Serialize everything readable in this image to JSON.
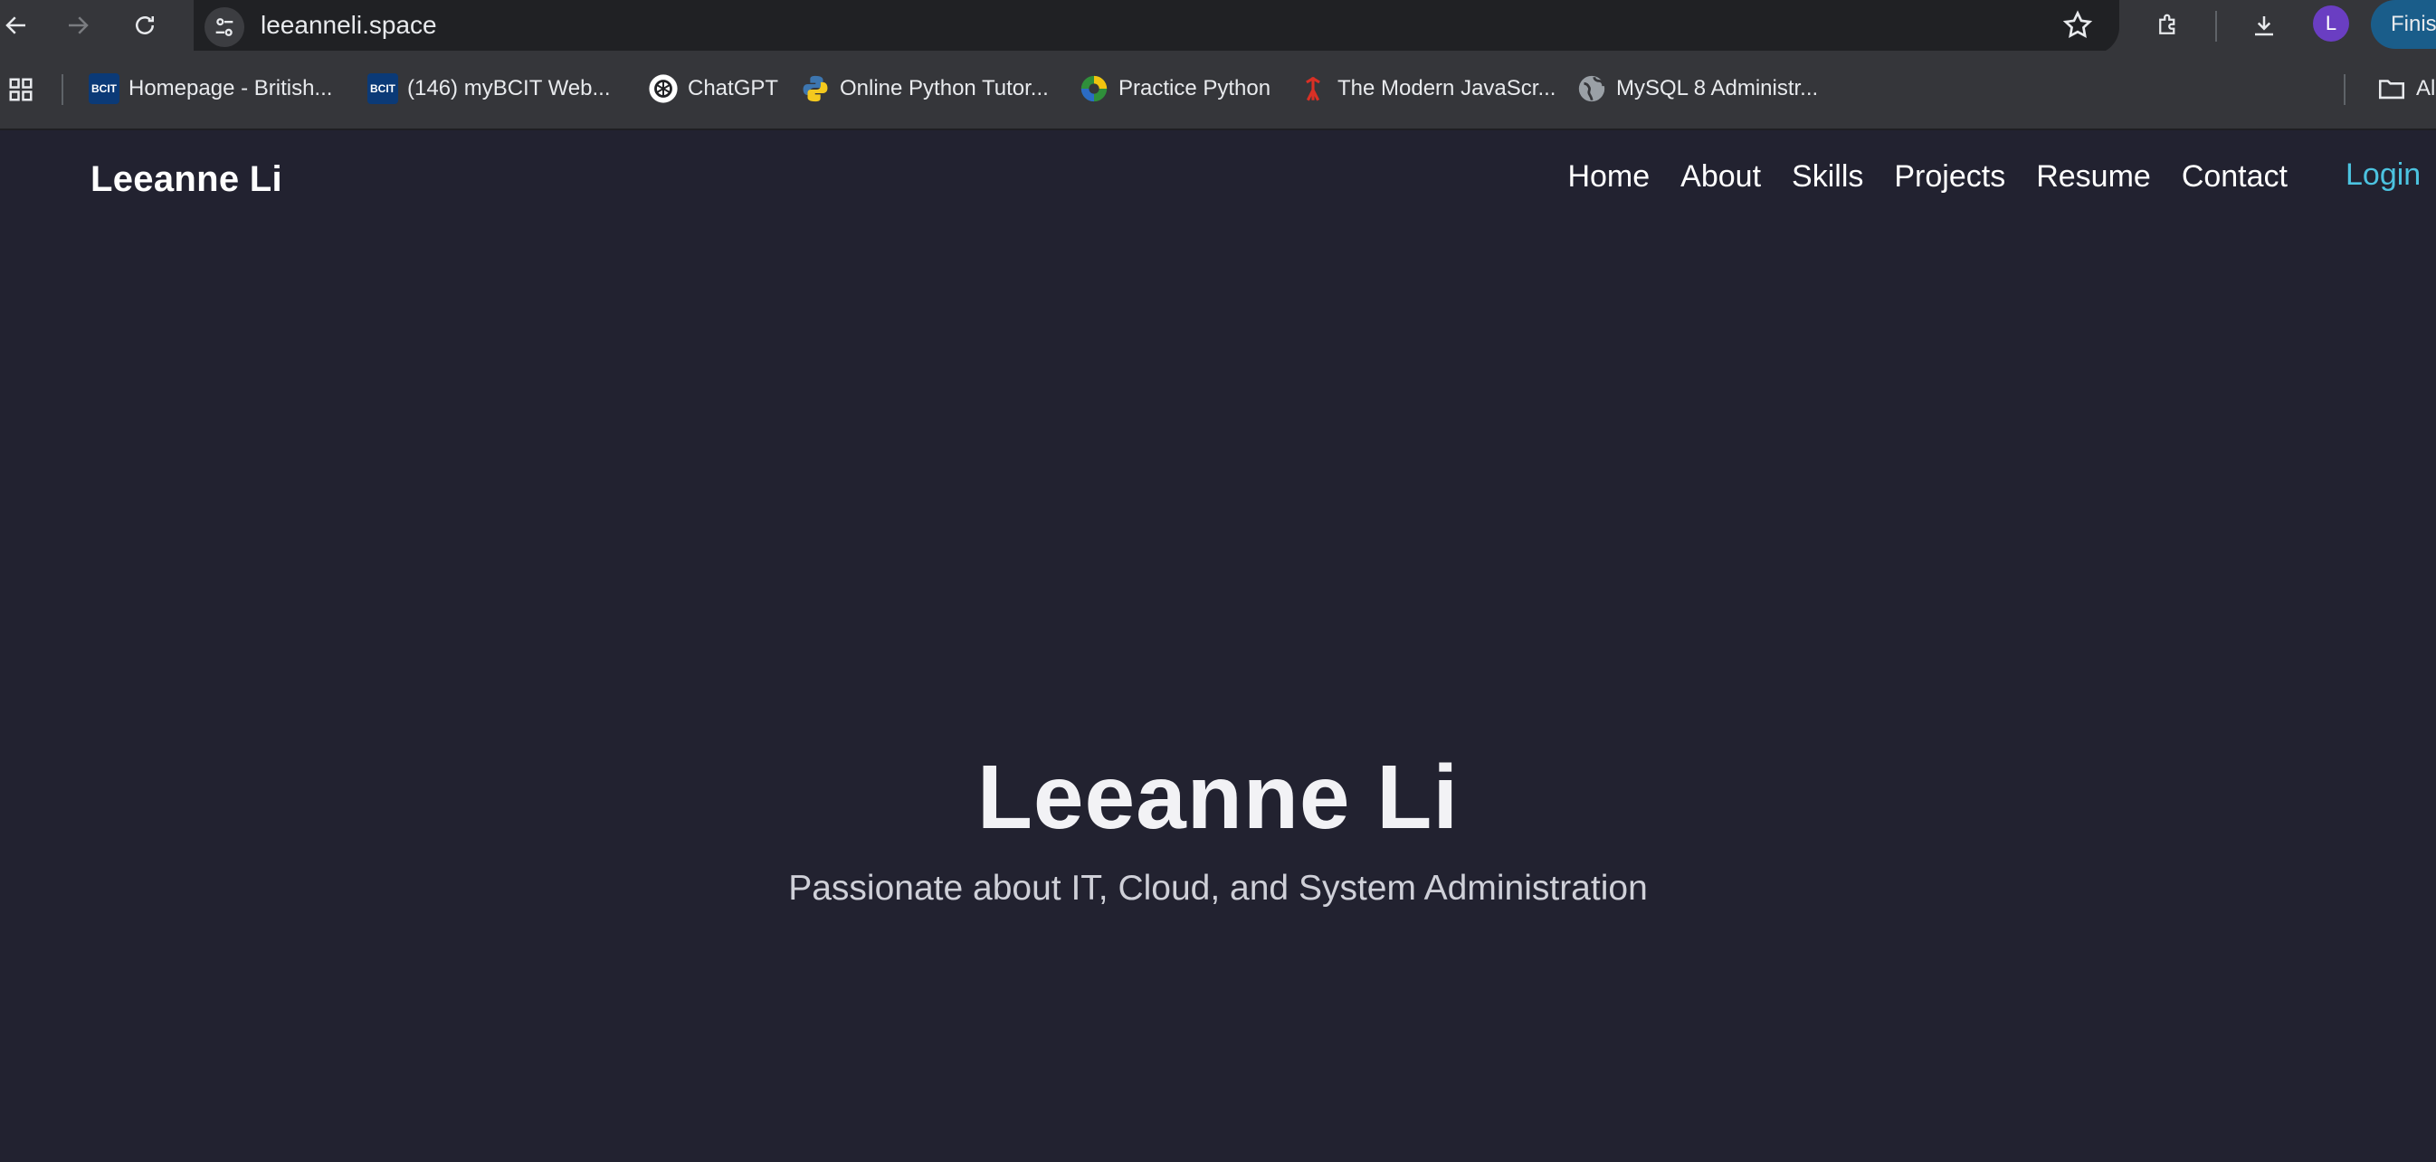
{
  "browser": {
    "url": "leeanneli.space",
    "avatar_letter": "L",
    "sync_pill": "Finis",
    "bookmarks": [
      {
        "label": "Homepage - British...",
        "icon": "bcit-icon"
      },
      {
        "label": "(146) myBCIT Web...",
        "icon": "bcit-icon"
      },
      {
        "label": "ChatGPT",
        "icon": "chatgpt-icon"
      },
      {
        "label": "Online Python Tutor...",
        "icon": "python-icon"
      },
      {
        "label": "Practice Python",
        "icon": "practice-python-icon"
      },
      {
        "label": "The Modern JavaScr...",
        "icon": "javascript-info-icon"
      },
      {
        "label": "MySQL 8 Administr...",
        "icon": "globe-icon"
      }
    ],
    "bookmarks_folder": "Al",
    "favicon_text": "BCIT"
  },
  "site": {
    "brand": "Leeanne Li",
    "nav": [
      "Home",
      "About",
      "Skills",
      "Projects",
      "Resume",
      "Contact"
    ],
    "login": "Login",
    "hero_title": "Leeanne Li",
    "hero_subtitle": "Passionate about IT, Cloud, and System Administration"
  },
  "colors": {
    "page_bg": "#222230",
    "chrome_bg": "#35363a",
    "omnibox_bg": "#202124",
    "login_accent": "#4cc3e0",
    "avatar_bg": "#6a3ec2"
  }
}
